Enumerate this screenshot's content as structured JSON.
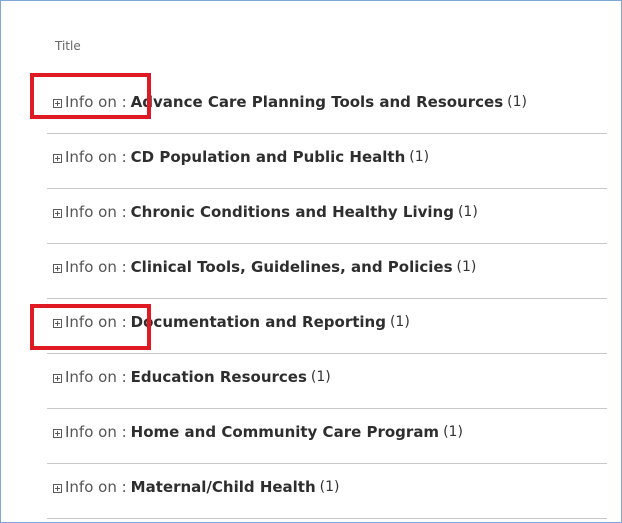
{
  "table": {
    "header": "Title",
    "items": [
      {
        "prefix": "Info on :",
        "label": "Advance Care Planning Tools and Resources",
        "count": "(1)",
        "highlighted": true
      },
      {
        "prefix": "Info on :",
        "label": "CD Population and Public Health",
        "count": "(1)",
        "highlighted": false
      },
      {
        "prefix": "Info on :",
        "label": "Chronic Conditions and Healthy Living",
        "count": "(1)",
        "highlighted": false
      },
      {
        "prefix": "Info on :",
        "label": "Clinical Tools, Guidelines, and Policies",
        "count": "(1)",
        "highlighted": false
      },
      {
        "prefix": "Info on :",
        "label": "Documentation and Reporting",
        "count": "(1)",
        "highlighted": true
      },
      {
        "prefix": "Info on :",
        "label": "Education Resources",
        "count": "(1)",
        "highlighted": false
      },
      {
        "prefix": "Info on :",
        "label": "Home and Community Care Program",
        "count": "(1)",
        "highlighted": false
      },
      {
        "prefix": "Info on :",
        "label": "Maternal/Child Health",
        "count": "(1)",
        "highlighted": false
      }
    ]
  },
  "colors": {
    "highlight_border": "#e01a22",
    "frame_border": "#7fa7d6"
  }
}
